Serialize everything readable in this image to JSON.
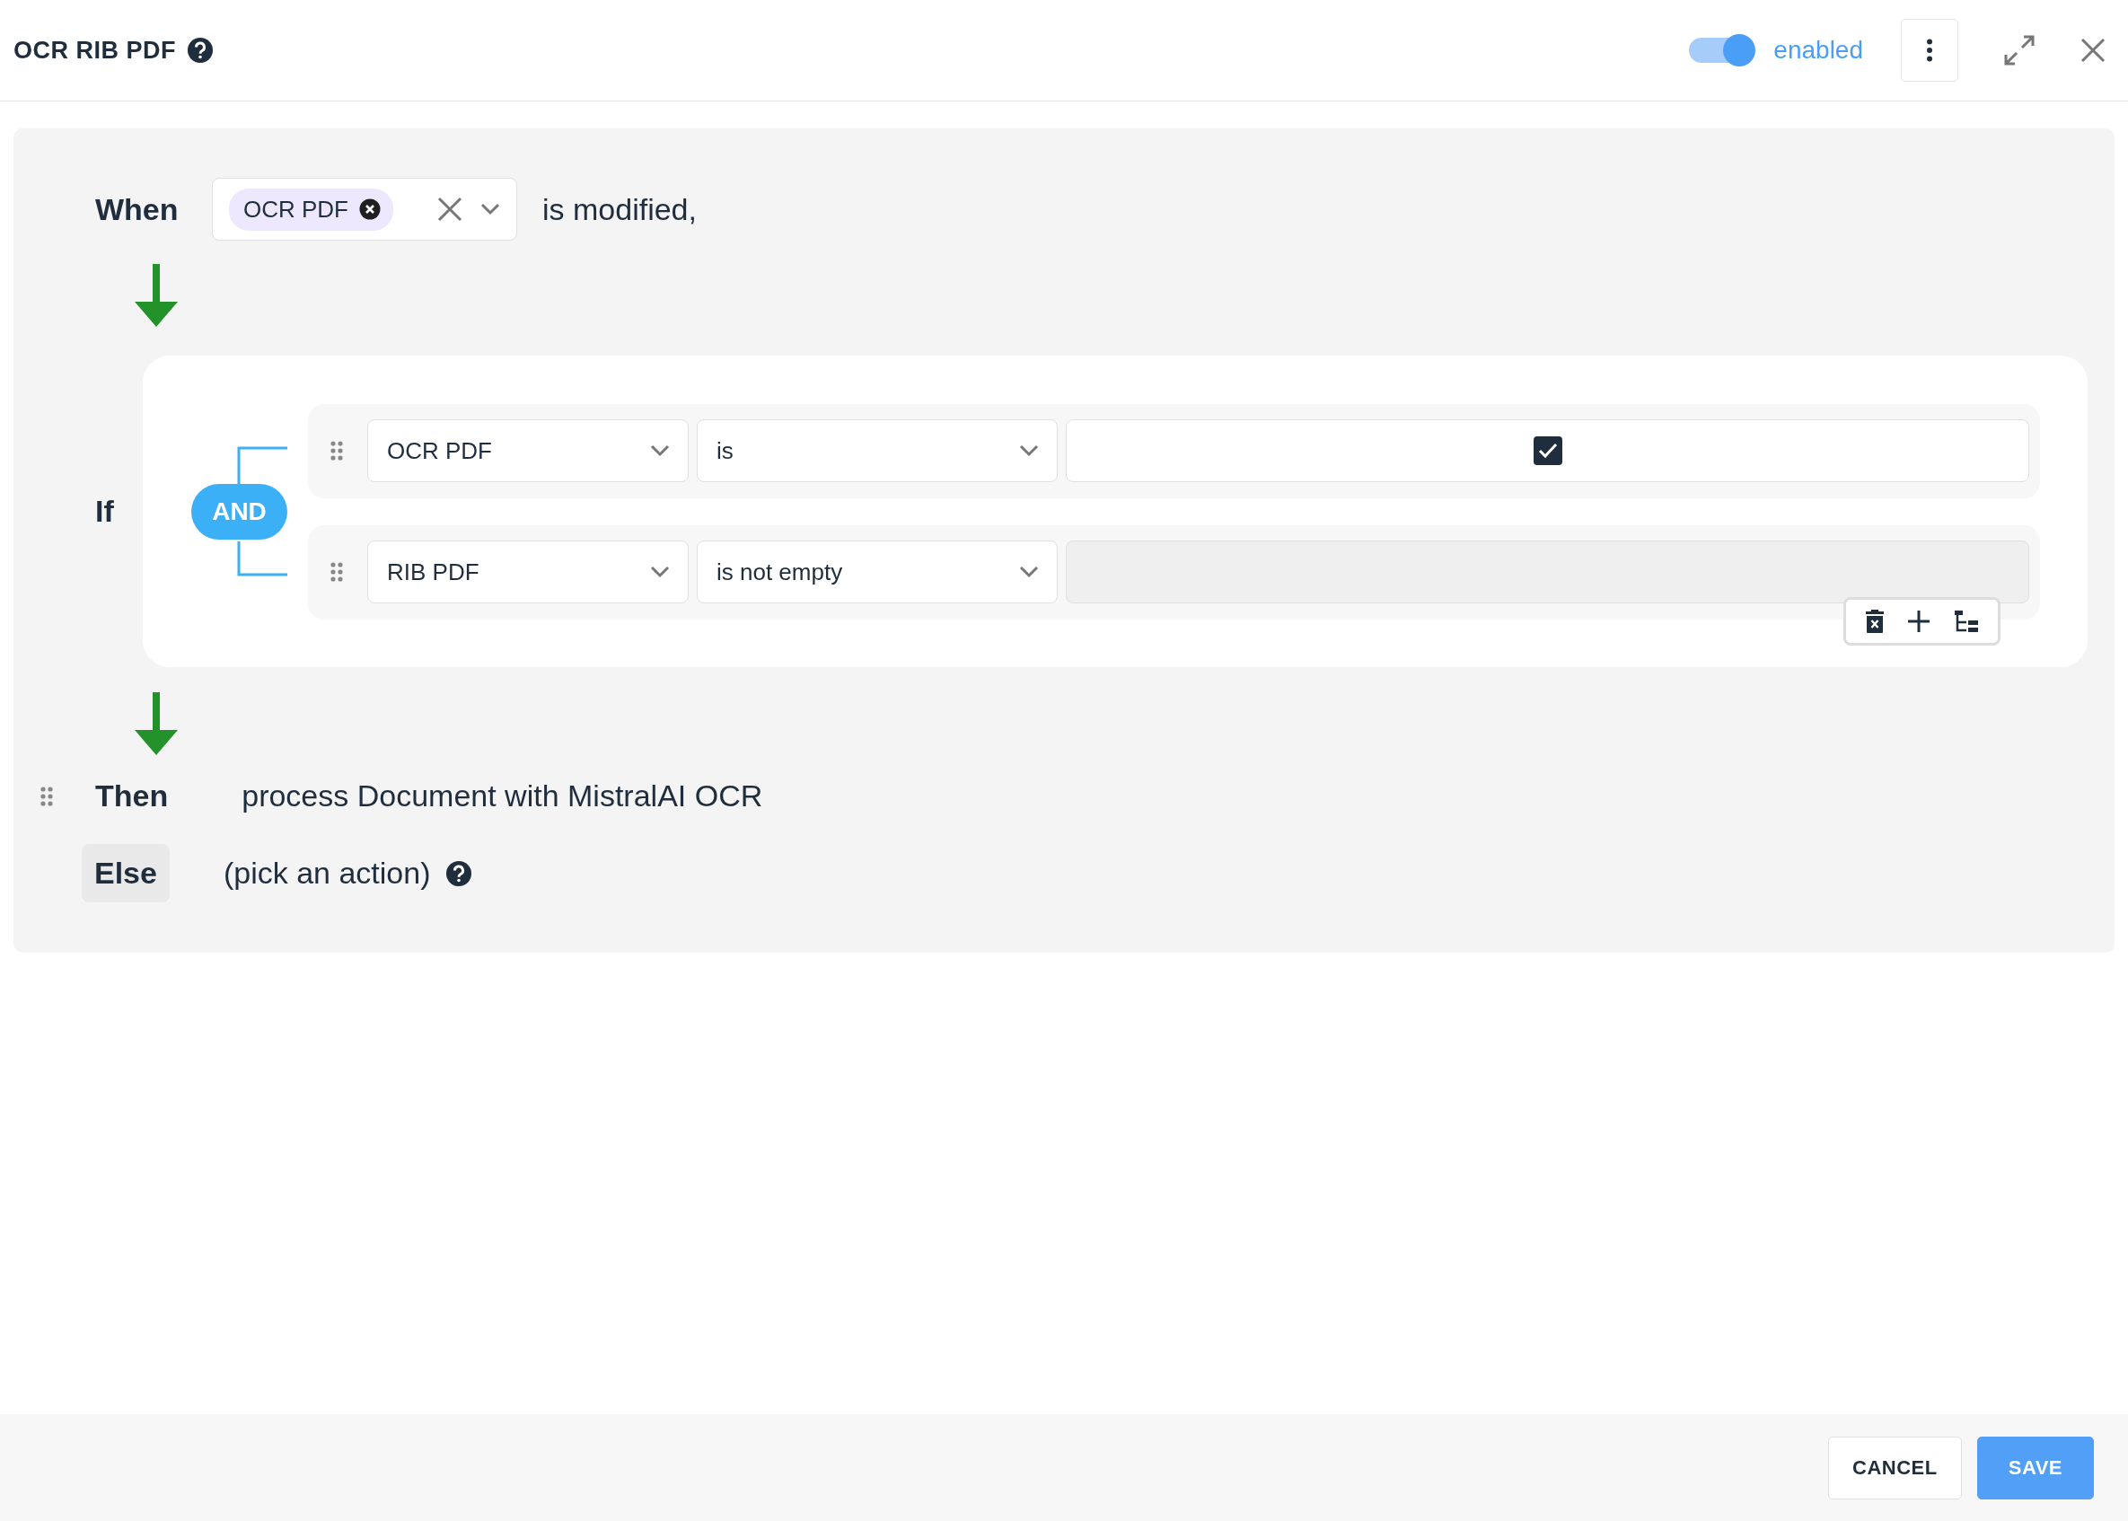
{
  "header": {
    "title": "OCR RIB PDF",
    "toggle": {
      "on": true,
      "label": "enabled"
    }
  },
  "when": {
    "label": "When",
    "tags": [
      {
        "label": "OCR PDF"
      }
    ],
    "suffix": "is modified,"
  },
  "if": {
    "label": "If",
    "operator": "AND",
    "conditions": [
      {
        "field": "OCR PDF",
        "op": "is",
        "kind": "checkbox",
        "checked": true
      },
      {
        "field": "RIB PDF",
        "op": "is not empty",
        "kind": "disabled"
      }
    ]
  },
  "then": {
    "label": "Then",
    "action": "process Document with MistralAI OCR"
  },
  "else": {
    "label": "Else",
    "action": "(pick an action)"
  },
  "footer": {
    "buttons": [
      {
        "label": "CANCEL",
        "kind": "secondary"
      },
      {
        "label": "SAVE",
        "kind": "primary"
      }
    ]
  }
}
